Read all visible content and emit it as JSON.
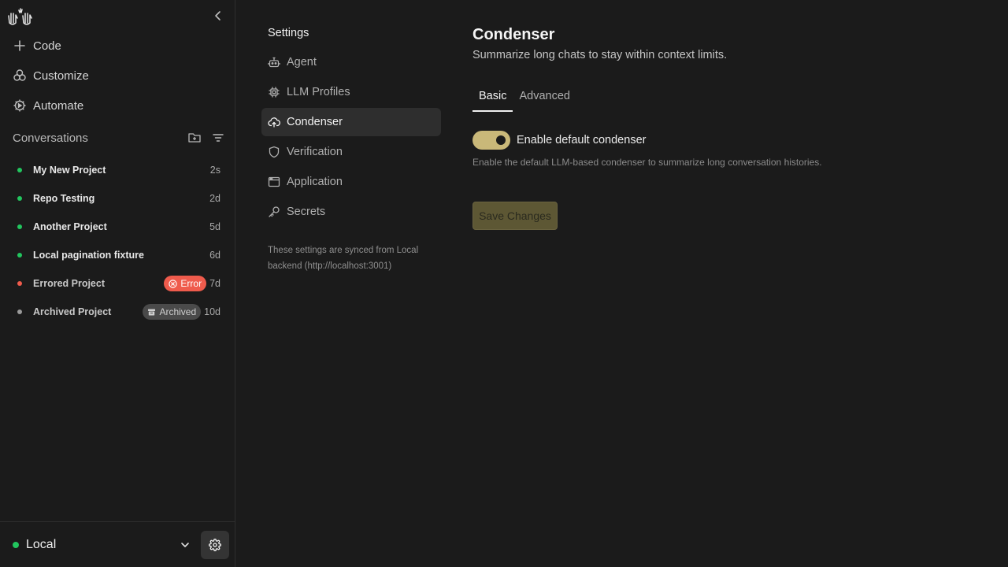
{
  "sidebar": {
    "nav": [
      {
        "label": "Code",
        "icon": "plus-icon"
      },
      {
        "label": "Customize",
        "icon": "customize-icon"
      },
      {
        "label": "Automate",
        "icon": "automate-icon"
      }
    ],
    "conversations_header": "Conversations",
    "conversations": [
      {
        "title": "My New Project",
        "age": "2s",
        "status_color": "#22c55e",
        "badge": null
      },
      {
        "title": "Repo Testing",
        "age": "2d",
        "status_color": "#22c55e",
        "badge": null
      },
      {
        "title": "Another Project",
        "age": "5d",
        "status_color": "#22c55e",
        "badge": null
      },
      {
        "title": "Local pagination fixture",
        "age": "6d",
        "status_color": "#22c55e",
        "badge": null
      },
      {
        "title": "Errored Project",
        "age": "7d",
        "status_color": "#ef5b4c",
        "badge": "Error"
      },
      {
        "title": "Archived Project",
        "age": "10d",
        "status_color": "#9a9a9a",
        "badge": "Archived"
      }
    ],
    "backend": {
      "name": "Local",
      "status_color": "#22c55e"
    }
  },
  "settings": {
    "title": "Settings",
    "nav": [
      {
        "label": "Agent",
        "icon": "robot-icon",
        "active": false
      },
      {
        "label": "LLM Profiles",
        "icon": "chip-icon",
        "active": false
      },
      {
        "label": "Condenser",
        "icon": "cloud-upload-icon",
        "active": true
      },
      {
        "label": "Verification",
        "icon": "shield-icon",
        "active": false
      },
      {
        "label": "Application",
        "icon": "window-icon",
        "active": false
      },
      {
        "label": "Secrets",
        "icon": "key-icon",
        "active": false
      }
    ],
    "sync_note": "These settings are synced from Local backend (http://localhost:3001)"
  },
  "main": {
    "title": "Condenser",
    "subtitle": "Summarize long chats to stay within context limits.",
    "tabs": [
      {
        "label": "Basic",
        "active": true
      },
      {
        "label": "Advanced",
        "active": false
      }
    ],
    "toggle": {
      "label": "Enable default condenser",
      "enabled": true
    },
    "toggle_help": "Enable the default LLM-based condenser to summarize long conversation histories.",
    "save_label": "Save Changes"
  },
  "colors": {
    "accent": "#c9b879",
    "success": "#22c55e",
    "error": "#ef5b4c",
    "archived": "#4a4a4a"
  }
}
